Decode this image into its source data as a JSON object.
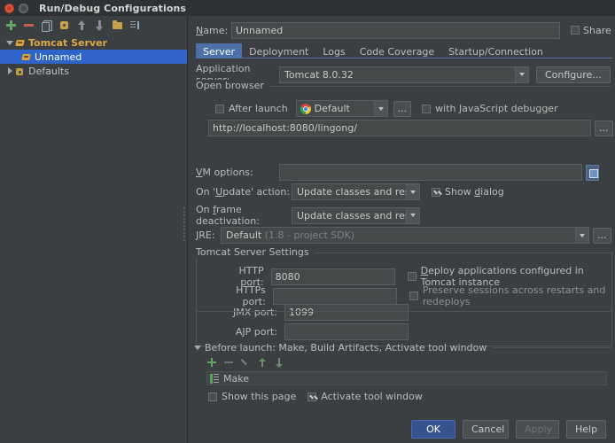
{
  "window": {
    "title": "Run/Debug Configurations",
    "close_icon": "close-icon",
    "minimize_icon": "minimize-icon"
  },
  "tree_toolbar": {
    "items": [
      {
        "name": "add-button",
        "icon": "plus-icon"
      },
      {
        "name": "remove-button",
        "icon": "minus-icon"
      },
      {
        "name": "copy-button",
        "icon": "copy-icon"
      },
      {
        "name": "save-configuration-button",
        "icon": "branch-icon"
      },
      {
        "name": "move-up-button",
        "icon": "arrow-up-icon"
      },
      {
        "name": "move-down-button",
        "icon": "arrow-down-icon"
      },
      {
        "name": "new-folder-button",
        "icon": "folder-icon"
      },
      {
        "name": "sort-button",
        "icon": "sort-icon"
      }
    ]
  },
  "tree": {
    "nodes": [
      {
        "label": "Tomcat Server",
        "icon": "tomcat-icon",
        "expanded": true,
        "selected": false,
        "level": 0
      },
      {
        "label": "Unnamed",
        "icon": "tomcat-icon",
        "expanded": false,
        "selected": true,
        "level": 1
      },
      {
        "label": "Defaults",
        "icon": "defaults-icon",
        "expanded": false,
        "selected": false,
        "level": 0
      }
    ]
  },
  "name_row": {
    "label": "Name:",
    "value": "Unnamed",
    "share_label": "Share",
    "share_checked": false
  },
  "tabs": [
    {
      "label": "Server",
      "active": true
    },
    {
      "label": "Deployment",
      "active": false
    },
    {
      "label": "Logs",
      "active": false
    },
    {
      "label": "Code Coverage",
      "active": false
    },
    {
      "label": "Startup/Connection",
      "active": false
    }
  ],
  "server_tab": {
    "application_server": {
      "label": "Application server:",
      "value": "Tomcat 8.0.32",
      "configure_label": "Configure..."
    },
    "open_browser": {
      "group_title": "Open browser",
      "after_launch_label": "After launch",
      "after_launch_checked": false,
      "browser_value": "Default",
      "browser_icon": "chrome-icon",
      "more_button_label": "...",
      "js_debugger_label": "with JavaScript debugger",
      "js_debugger_checked": false,
      "url_value": "http://localhost:8080/lingong/",
      "url_more_label": "..."
    },
    "vm_options": {
      "label": "VM options:",
      "value": "",
      "expand_icon": "expand-editor-icon"
    },
    "on_update": {
      "label": "On 'Update' action:",
      "value": "Update classes and resources",
      "show_dialog_label": "Show dialog",
      "show_dialog_checked": true
    },
    "on_frame_deactivation": {
      "label": "On frame deactivation:",
      "value": "Update classes and resources"
    },
    "jre": {
      "label": "JRE:",
      "value": "Default",
      "value_hint": "(1.8 - project SDK)",
      "more_label": "..."
    },
    "tomcat_settings": {
      "group_title": "Tomcat Server Settings",
      "http_port_label": "HTTP port:",
      "http_port_value": "8080",
      "https_port_label": "HTTPs port:",
      "https_port_value": "",
      "jmx_port_label": "JMX port:",
      "jmx_port_value": "1099",
      "ajp_port_label": "AJP port:",
      "ajp_port_value": "",
      "deploy_apps_label": "Deploy applications configured in Tomcat instance",
      "deploy_apps_checked": false,
      "preserve_sessions_label": "Preserve sessions across restarts and redeploys",
      "preserve_sessions_checked": false
    }
  },
  "before_launch": {
    "title": "Before launch: Make, Build Artifacts, Activate tool window",
    "toolbar": [
      {
        "name": "add-task-button",
        "icon": "plus-icon"
      },
      {
        "name": "remove-task-button",
        "icon": "minus-icon"
      },
      {
        "name": "edit-task-button",
        "icon": "pencil-icon"
      },
      {
        "name": "move-task-up-button",
        "icon": "arrow-up-icon"
      },
      {
        "name": "move-task-down-button",
        "icon": "arrow-down-icon"
      }
    ],
    "tasks": [
      {
        "label": "Make",
        "icon": "make-icon"
      }
    ],
    "show_this_page_label": "Show this page",
    "show_this_page_checked": false,
    "activate_tool_window_label": "Activate tool window",
    "activate_tool_window_checked": true
  },
  "footer_buttons": [
    {
      "label": "OK",
      "style": "primary",
      "disabled": false
    },
    {
      "label": "Cancel",
      "style": "normal",
      "disabled": false
    },
    {
      "label": "Apply",
      "style": "normal",
      "disabled": true
    },
    {
      "label": "Help",
      "style": "normal",
      "disabled": false
    }
  ],
  "colors": {
    "background": "#3c3f41",
    "titlebar": "#2f3234",
    "selection": "#2f65c8",
    "accent_tab": "#4d6fa8",
    "tree_accent": "#d9a94a",
    "primary_button": "#36538f"
  }
}
